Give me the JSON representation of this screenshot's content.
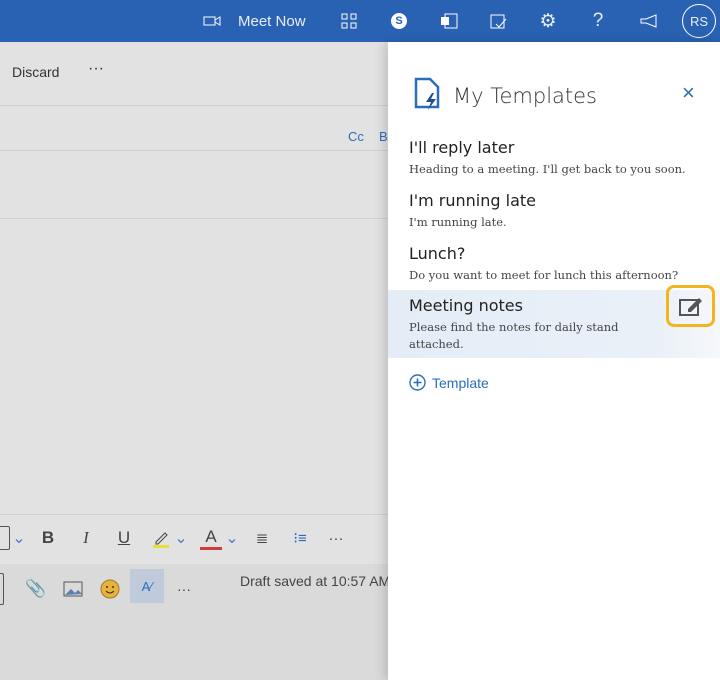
{
  "topbar": {
    "meet_now": "Meet Now",
    "help": "?",
    "avatar": "RS"
  },
  "compose": {
    "discard": "Discard",
    "more": "···",
    "cc": "Cc",
    "bcc": "B",
    "draft_status": "Draft saved at 10:57 AM"
  },
  "format_toolbar": {
    "bold": "B",
    "italic": "I",
    "underline": "U",
    "font_color": "A",
    "more": "···"
  },
  "bottom_toolbar": {
    "more": "···"
  },
  "panel": {
    "title": "My Templates",
    "add_label": "Template",
    "templates": [
      {
        "title": "I'll reply later",
        "body": "Heading to a meeting. I'll get back to you soon."
      },
      {
        "title": "I'm running late",
        "body": "I'm running late."
      },
      {
        "title": "Lunch?",
        "body": "Do you want to meet for lunch this afternoon?"
      },
      {
        "title": "Meeting notes",
        "body": "Please find the notes for daily stand attached."
      }
    ]
  },
  "colors": {
    "topbar": "#2a62b3",
    "accent": "#2a6ebb",
    "highlight": "#f2b51d"
  }
}
